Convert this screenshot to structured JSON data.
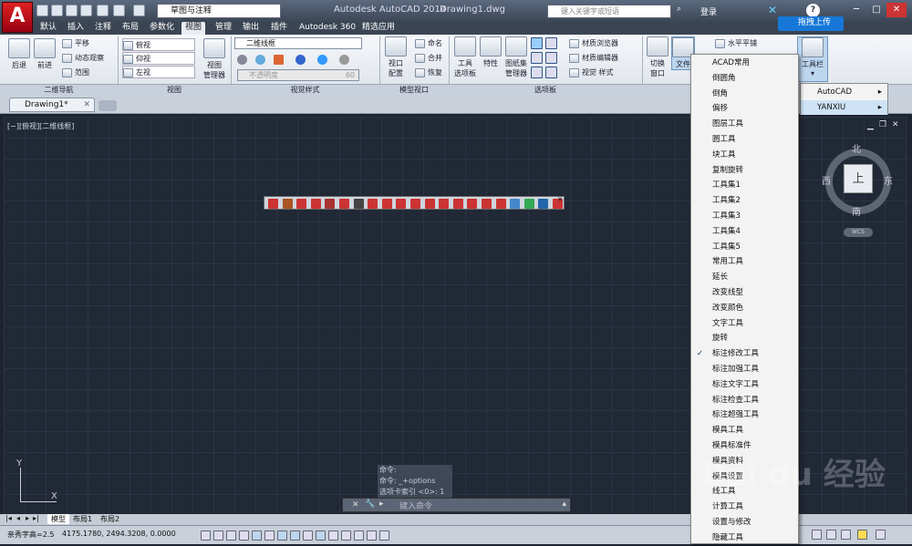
{
  "app": {
    "logo": "A",
    "title": "Autodesk AutoCAD 2014",
    "document": "Drawing1.dwg",
    "workspace": "草图与注释",
    "search_placeholder": "键入关键字或短语",
    "login": "登录",
    "upload": "拖拽上传"
  },
  "tabs": [
    "默认",
    "插入",
    "注释",
    "布局",
    "参数化",
    "视图",
    "管理",
    "输出",
    "插件",
    "Autodesk 360",
    "精选应用"
  ],
  "active_tab": "视图",
  "ribbon": {
    "nav": {
      "back": "后退",
      "forward": "前进",
      "pan": "平移",
      "orbit": "动态观察",
      "extents": "范围",
      "title": "二维导航"
    },
    "views": {
      "items": [
        "俯视",
        "仰视",
        "左视"
      ],
      "manager": "视图",
      "manager2": "管理器",
      "title": "视图"
    },
    "visual": {
      "style": "二维线框",
      "opacity": "不透明度",
      "opacity_val": "60",
      "title": "视觉样式"
    },
    "model": {
      "config": "视口",
      "config2": "配置",
      "name": "命名",
      "join": "合并",
      "restore": "恢复",
      "title": "模型视口"
    },
    "palettes": {
      "tool": "工具",
      "tool2": "选项板",
      "props": "特性",
      "sheetset": "图纸集",
      "sheetset2": "管理器",
      "matbrowser": "材质浏览器",
      "mateditor": "材质编辑器",
      "visual": "视觉 样式",
      "title": "选项板"
    },
    "windows": {
      "switch": "切换",
      "switch2": "窗口",
      "file": "文件",
      "tile": "水平平铺",
      "toolbars": "工具栏"
    }
  },
  "doc_tab": "Drawing1*",
  "viewport_label": "[−][俯视][二维线框]",
  "compass": {
    "n": "北",
    "s": "南",
    "e": "东",
    "w": "西",
    "top": "上",
    "wcs": "WCS"
  },
  "command": {
    "history": [
      "命令:",
      "命令: _+options",
      "选项卡索引 <0>: 1"
    ],
    "placeholder": "键入命令"
  },
  "layout_tabs": [
    "模型",
    "布局1",
    "布局2"
  ],
  "status": {
    "text": "亲秀字高=2.5",
    "coords": "4175.1780, 2494.3208, 0.0000"
  },
  "submenu": [
    "AutoCAD",
    "YANXIU"
  ],
  "menu": [
    "ACAD常用",
    "倒圆角",
    "倒角",
    "偏移",
    "图层工具",
    "圆工具",
    "块工具",
    "复制旋转",
    "工具集1",
    "工具集2",
    "工具集3",
    "工具集4",
    "工具集5",
    "常用工具",
    "延长",
    "改变线型",
    "改变颜色",
    "文字工具",
    "旋转",
    "标注修改工具",
    "标注加强工具",
    "标注文字工具",
    "标注检查工具",
    "标注超强工具",
    "模具工具",
    "模具标准件",
    "模具资料",
    "模具设置",
    "线工具",
    "计算工具",
    "设置与修改",
    "隐藏工具"
  ],
  "menu_checked": "标注修改工具",
  "watermark": "Bai du 经验",
  "colors": {
    "canvas": "#212836",
    "menu_bg": "#f3f3f3",
    "accent": "#1677d8"
  }
}
